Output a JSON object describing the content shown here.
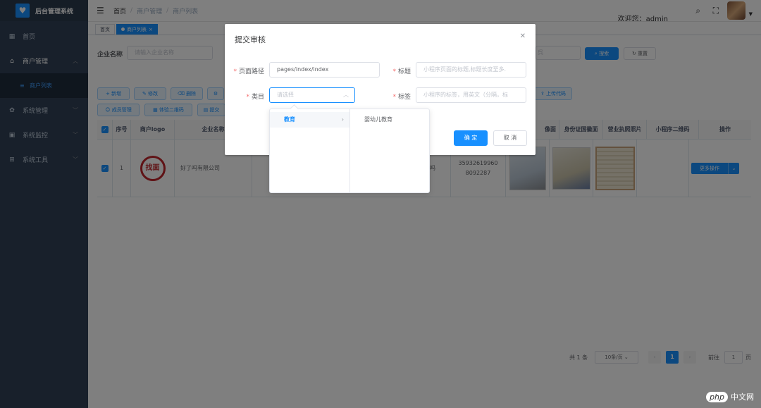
{
  "app": {
    "title": "后台管理系统",
    "logo_icon": "heart-icon"
  },
  "sidebar": {
    "items": [
      {
        "label": "首页",
        "icon": "dashboard-icon"
      },
      {
        "label": "商户管理",
        "icon": "shop-icon"
      },
      {
        "label": "商户列表",
        "icon": "list-icon"
      },
      {
        "label": "系统管理",
        "icon": "gear-icon"
      },
      {
        "label": "系统监控",
        "icon": "monitor-icon"
      },
      {
        "label": "系统工具",
        "icon": "tool-icon"
      }
    ]
  },
  "header": {
    "breadcrumb": [
      "首页",
      "商户管理",
      "商户列表"
    ],
    "welcome": "欢迎您：admin"
  },
  "tags": {
    "home": "首页",
    "active": "商户列表"
  },
  "search": {
    "label": "企业名称",
    "placeholder": "请输入企业名称",
    "placeholder2": "呉",
    "search_btn": "搜索",
    "reset_btn": "重置"
  },
  "toolbar": {
    "add": "+ 新增",
    "edit": "修改",
    "delete": "删除",
    "upload": "上传代码",
    "member": "成员管理",
    "qrcode": "体验二维码",
    "submit": "提交"
  },
  "table": {
    "headers": [
      "序号",
      "商户logo",
      "企业名称",
      "像面",
      "身份证国徽面",
      "营业执照照片",
      "小程序二维码",
      "操作"
    ],
    "row": {
      "index": "1",
      "logo_text": "找面",
      "company": "好了吗有限公司",
      "partial": "吗",
      "phone": "35932619960\n8092287",
      "op": "更多操作"
    }
  },
  "pagination": {
    "total": "共 1 条",
    "page_size": "10条/页",
    "current": "1",
    "goto_label": "前往",
    "goto_value": "1",
    "page_unit": "页"
  },
  "dialog": {
    "title": "提交审核",
    "path_label": "页面路径",
    "path_value": "pages/index/index",
    "title_label": "标题",
    "title_placeholder": "小程序页面的标题,标题长度至多.",
    "category_label": "类目",
    "category_placeholder": "请选择",
    "tag_label": "标签",
    "tag_placeholder": "小程序的标签，用英文（分隔，标",
    "confirm": "确 定",
    "cancel": "取 消"
  },
  "cascader": {
    "level1": [
      {
        "label": "教育"
      }
    ],
    "level2": [
      {
        "label": "婴幼儿教育"
      }
    ]
  },
  "watermark": {
    "badge": "php",
    "text": "中文网"
  }
}
